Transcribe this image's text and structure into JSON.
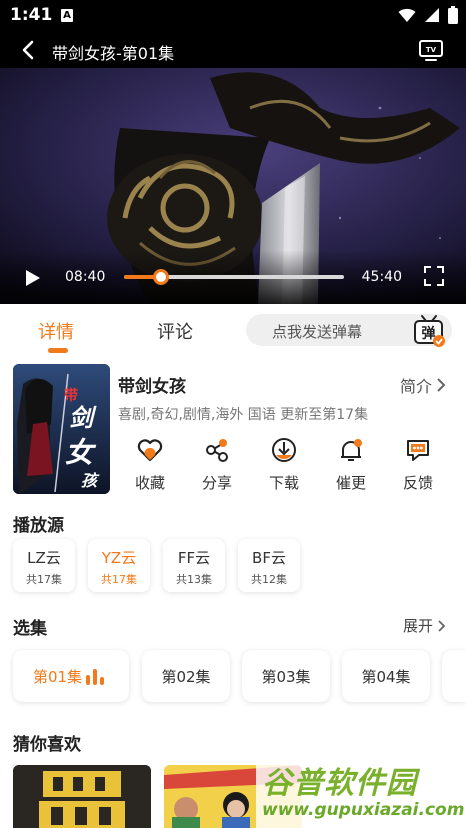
{
  "status_bar": {
    "time": "1:41",
    "badge": "A"
  },
  "header": {
    "title": "带剑女孩-第01集"
  },
  "player": {
    "current_time": "08:40",
    "total_time": "45:40",
    "progress_fraction": 0.17
  },
  "tabs": [
    {
      "label": "详情",
      "active": true
    },
    {
      "label": "评论",
      "active": false
    }
  ],
  "danmu": {
    "placeholder": "点我发送弹幕",
    "icon_label": "弹"
  },
  "show": {
    "poster_text": "带剑女孩",
    "name": "带剑女孩",
    "intro_label": "简介",
    "meta": "喜剧,奇幻,剧情,海外 国语 更新至第17集"
  },
  "actions": [
    {
      "label": "收藏",
      "icon": "heart-icon"
    },
    {
      "label": "分享",
      "icon": "share-icon"
    },
    {
      "label": "下载",
      "icon": "download-icon"
    },
    {
      "label": "催更",
      "icon": "bell-icon"
    },
    {
      "label": "反馈",
      "icon": "feedback-icon"
    }
  ],
  "sources": {
    "title": "播放源",
    "items": [
      {
        "name": "LZ云",
        "count": "共17集",
        "active": false
      },
      {
        "name": "YZ云",
        "count": "共17集",
        "active": true
      },
      {
        "name": "FF云",
        "count": "共13集",
        "active": false
      },
      {
        "name": "BF云",
        "count": "共12集",
        "active": false
      }
    ]
  },
  "episodes": {
    "title": "选集",
    "expand_label": "展开",
    "items": [
      {
        "label": "第01集",
        "active": true
      },
      {
        "label": "第02集",
        "active": false
      },
      {
        "label": "第03集",
        "active": false
      },
      {
        "label": "第04集",
        "active": false
      }
    ]
  },
  "recommend": {
    "title": "猜你喜欢"
  },
  "watermark": {
    "main": "谷普软件园",
    "url": "www.gupuxiazai.com"
  },
  "colors": {
    "accent": "#f27a1a",
    "text": "#222222",
    "muted": "#777777"
  }
}
